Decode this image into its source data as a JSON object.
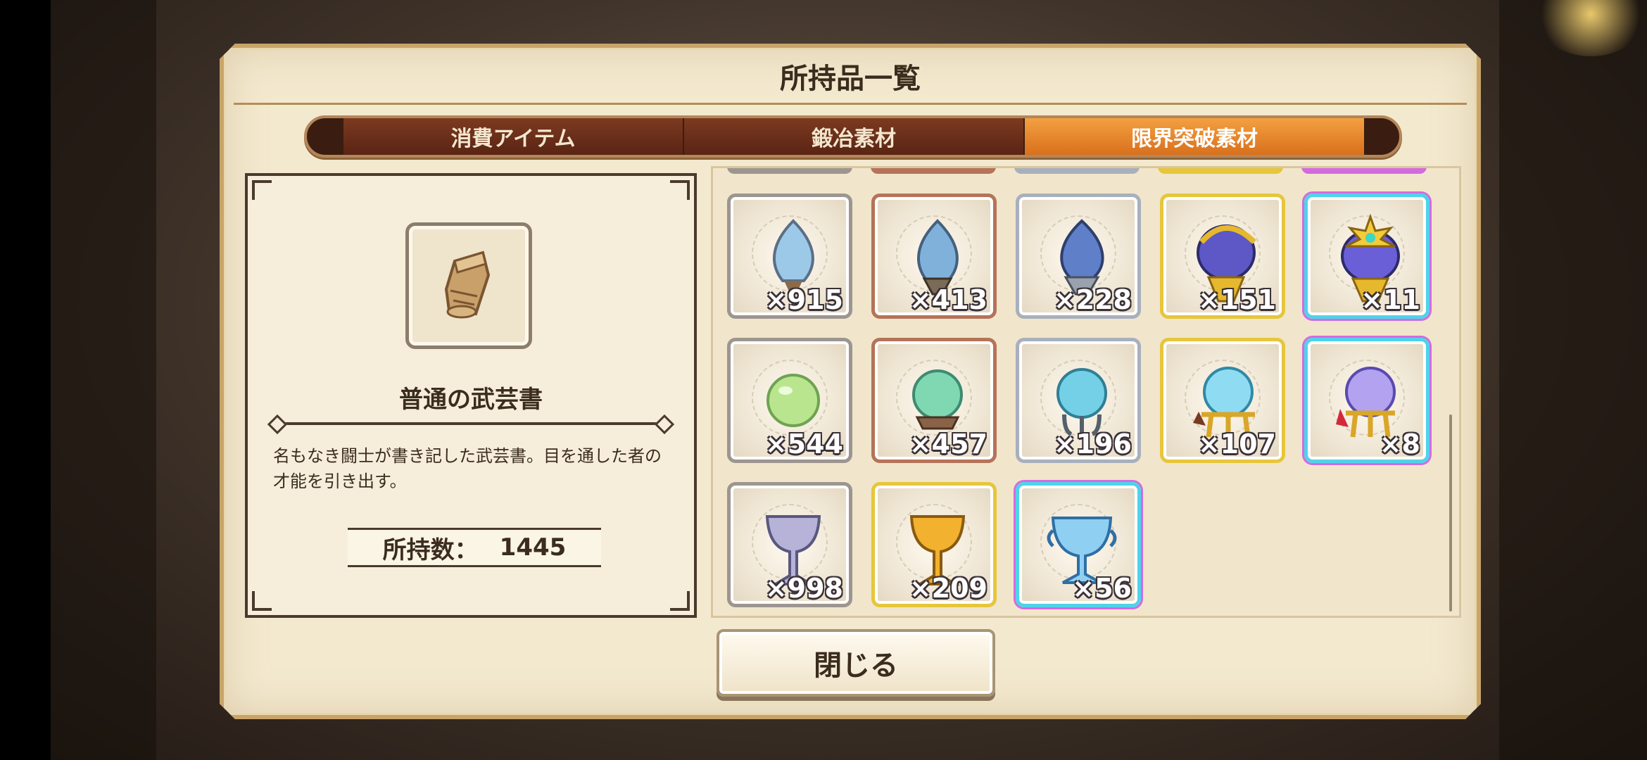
{
  "panel": {
    "title": "所持品一覧"
  },
  "tabs": [
    {
      "label": "消費アイテム",
      "active": false
    },
    {
      "label": "鍛冶素材",
      "active": false
    },
    {
      "label": "限界突破素材",
      "active": true
    }
  ],
  "detail": {
    "icon": "scroll-icon",
    "name": "普通の武芸書",
    "description": "名もなき闘士が書き記した武芸書。目を通した者の才能を引き出す。",
    "owned_label": "所持数：",
    "owned_value": "1445"
  },
  "grid": {
    "items": [
      {
        "icon": "blue-flame-gem-icon",
        "count": "×915",
        "rarity": "common"
      },
      {
        "icon": "blue-flame-gem-icon",
        "count": "×413",
        "rarity": "copper"
      },
      {
        "icon": "blue-flame-gem-icon",
        "count": "×228",
        "rarity": "silver"
      },
      {
        "icon": "ornate-blue-flame-gem-icon",
        "count": "×151",
        "rarity": "gold"
      },
      {
        "icon": "ornate-blue-flame-gem-icon",
        "count": "×11",
        "rarity": "rainbow"
      },
      {
        "icon": "green-orb-icon",
        "count": "×544",
        "rarity": "common"
      },
      {
        "icon": "teal-orb-icon",
        "count": "×457",
        "rarity": "copper"
      },
      {
        "icon": "blue-orb-icon",
        "count": "×196",
        "rarity": "silver"
      },
      {
        "icon": "crystal-orb-icon",
        "count": "×107",
        "rarity": "gold"
      },
      {
        "icon": "violet-orb-icon",
        "count": "×8",
        "rarity": "rainbow"
      },
      {
        "icon": "silver-chalice-icon",
        "count": "×998",
        "rarity": "common"
      },
      {
        "icon": "gold-chalice-icon",
        "count": "×209",
        "rarity": "gold"
      },
      {
        "icon": "crystal-chalice-icon",
        "count": "×56",
        "rarity": "rainbow"
      }
    ]
  },
  "close_button": {
    "label": "閉じる"
  }
}
